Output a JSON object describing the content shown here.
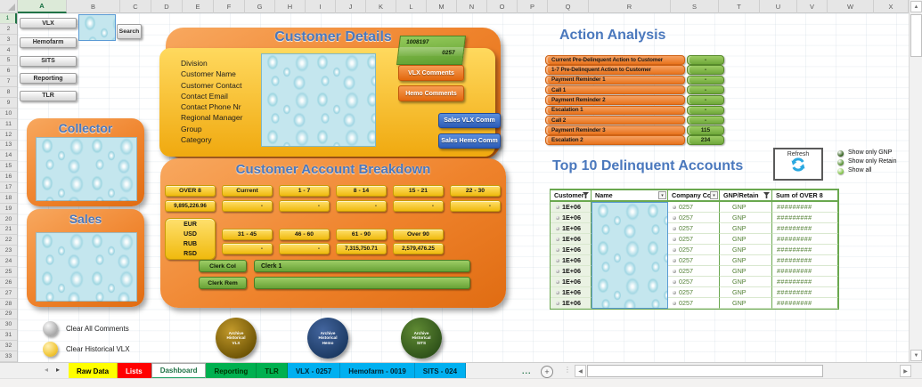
{
  "grid": {
    "columns": [
      "A",
      "B",
      "C",
      "D",
      "E",
      "F",
      "G",
      "H",
      "I",
      "J",
      "K",
      "L",
      "M",
      "N",
      "O",
      "P",
      "Q",
      "R",
      "S",
      "T",
      "U",
      "V",
      "W",
      "X"
    ],
    "selected_column": "A",
    "row_count": 33,
    "selected_row": 1
  },
  "nav_buttons": [
    {
      "label": "VLX"
    },
    {
      "label": "Hemofarm"
    },
    {
      "label": "SITS"
    },
    {
      "label": "Reporting"
    },
    {
      "label": "TLR"
    }
  ],
  "search": {
    "button_label": "Search"
  },
  "collector": {
    "title": "Collector"
  },
  "sales": {
    "title": "Sales"
  },
  "customer_details": {
    "title": "Customer Details",
    "field_labels": [
      "Division",
      "Customer Name",
      "Customer Contact",
      "Contact Email",
      "Contact Phone Nr",
      "Regional Manager",
      "Group",
      "Category"
    ],
    "tag": {
      "code_top": "1008197",
      "code_bottom": "0257"
    },
    "comment_buttons": [
      {
        "label": "VLX Comments"
      },
      {
        "label": "Hemo Comments"
      }
    ],
    "sales_comment_buttons": [
      {
        "label": "Sales VLX Comm"
      },
      {
        "label": "Sales Hemo Comm"
      }
    ]
  },
  "account_breakdown": {
    "title": "Customer Account Breakdown",
    "aging_row1": [
      {
        "label": "OVER 8",
        "value": "9,895,226.96"
      },
      {
        "label": "Current",
        "value": "-"
      },
      {
        "label": "1 - 7",
        "value": "-"
      },
      {
        "label": "8 - 14",
        "value": "-"
      },
      {
        "label": "15 - 21",
        "value": "-"
      },
      {
        "label": "22 - 30",
        "value": "-"
      }
    ],
    "currencies": [
      "EUR",
      "USD",
      "RUB",
      "RSD"
    ],
    "aging_row2": [
      {
        "label": "31 - 45",
        "value": "-"
      },
      {
        "label": "46 - 60",
        "value": "-"
      },
      {
        "label": "61 - 90",
        "value": "7,315,750.71"
      },
      {
        "label": "Over 90",
        "value": "2,579,476.25"
      }
    ],
    "clerk_col": {
      "label": "Clerk Col",
      "value": "Clerk 1"
    },
    "clerk_rem": {
      "label": "Clerk Rem",
      "value": ""
    }
  },
  "action_analysis": {
    "title": "Action Analysis",
    "rows": [
      {
        "label": "Current Pre-Delinquent Action to Customer",
        "value": "-"
      },
      {
        "label": "1-7 Pre-Delinquent Action to Customer",
        "value": "-"
      },
      {
        "label": "Payment Reminder 1",
        "value": "-"
      },
      {
        "label": "Call 1",
        "value": "-"
      },
      {
        "label": "Payment Reminder 2",
        "value": "-"
      },
      {
        "label": "Escalation 1",
        "value": "-"
      },
      {
        "label": "Call 2",
        "value": "-"
      },
      {
        "label": "Payment Reminder 3",
        "value": "115"
      },
      {
        "label": "Escalation 2",
        "value": "234"
      }
    ]
  },
  "refresh_label": "Refresh",
  "filter_options": [
    {
      "label": "Show only GNP",
      "dot_color": "#2a5b14"
    },
    {
      "label": "Show only Retain",
      "dot_color": "#4d8b28"
    },
    {
      "label": "Show all",
      "dot_color": "#7cc140"
    }
  ],
  "top10": {
    "title": "Top 10 Delinquent Accounts",
    "headers": [
      {
        "label": "Customer",
        "icon": "filter"
      },
      {
        "label": "Name",
        "icon": "dropdown"
      },
      {
        "label": "Company Co",
        "icon": "dropdown"
      },
      {
        "label": "GNP/Retain",
        "icon": "filter"
      },
      {
        "label": "Sum of OVER 8",
        "icon": "none"
      }
    ],
    "rows": [
      {
        "customer": "1E+06",
        "company_code": "0257",
        "gnp_retain": "GNP",
        "sum_over8": "#########"
      },
      {
        "customer": "1E+06",
        "company_code": "0257",
        "gnp_retain": "GNP",
        "sum_over8": "#########"
      },
      {
        "customer": "1E+06",
        "company_code": "0257",
        "gnp_retain": "GNP",
        "sum_over8": "#########"
      },
      {
        "customer": "1E+06",
        "company_code": "0257",
        "gnp_retain": "GNP",
        "sum_over8": "#########"
      },
      {
        "customer": "1E+06",
        "company_code": "0257",
        "gnp_retain": "GNP",
        "sum_over8": "#########"
      },
      {
        "customer": "1E+06",
        "company_code": "0257",
        "gnp_retain": "GNP",
        "sum_over8": "#########"
      },
      {
        "customer": "1E+06",
        "company_code": "0257",
        "gnp_retain": "GNP",
        "sum_over8": "#########"
      },
      {
        "customer": "1E+06",
        "company_code": "0257",
        "gnp_retain": "GNP",
        "sum_over8": "#########"
      },
      {
        "customer": "1E+06",
        "company_code": "0257",
        "gnp_retain": "GNP",
        "sum_over8": "#########"
      },
      {
        "customer": "1E+06",
        "company_code": "0257",
        "gnp_retain": "GNP",
        "sum_over8": "#########"
      }
    ]
  },
  "footer": {
    "clear_all_label": "Clear All Comments",
    "clear_vlx_label": "Clear Historical VLX",
    "archive_buttons": [
      {
        "label_lines": [
          "Archive",
          "Historical",
          "VLX"
        ],
        "color_center": "#c2992a",
        "color_edge": "#6e5405"
      },
      {
        "label_lines": [
          "Archive",
          "Historical",
          "Hemo"
        ],
        "color_center": "#43659e",
        "color_edge": "#1c3a63"
      },
      {
        "label_lines": [
          "Archive",
          "Historical",
          "SITS"
        ],
        "color_center": "#5f8a33",
        "color_edge": "#2f521a"
      }
    ]
  },
  "tab_bar": {
    "tabs": [
      {
        "label": "Raw Data",
        "bg": "#ffff00",
        "fg": "#000000",
        "active": false
      },
      {
        "label": "Lists",
        "bg": "#ff0000",
        "fg": "#ffffff",
        "active": false
      },
      {
        "label": "Dashboard",
        "bg": "#ffffff",
        "fg": "#1e7145",
        "active": true
      },
      {
        "label": "Reporting",
        "bg": "#00b050",
        "fg": "#003300",
        "active": false
      },
      {
        "label": "TLR",
        "bg": "#00b050",
        "fg": "#003300",
        "active": false
      },
      {
        "label": "VLX - 0257",
        "bg": "#00b0f0",
        "fg": "#00222e",
        "active": false
      },
      {
        "label": "Hemofarm - 0019",
        "bg": "#00b0f0",
        "fg": "#00222e",
        "active": false
      },
      {
        "label": "SITS - 024",
        "bg": "#00b0f0",
        "fg": "#00222e",
        "active": false
      }
    ],
    "overflow_label": "...",
    "add_sheet_label": "+"
  }
}
